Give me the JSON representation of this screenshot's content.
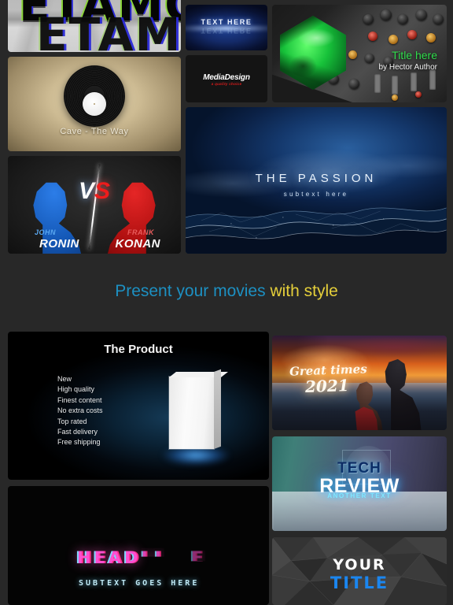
{
  "background_color": "#282828",
  "headline": {
    "part1": "Present your movies",
    "part2": "with style",
    "color1": "#1d90c2",
    "color2": "#e5cf3a"
  },
  "cards": {
    "chrome": {
      "name": "chrome-text-preview",
      "line1": "ETAMO",
      "line2": "ETAMO"
    },
    "text_here": {
      "name": "text-here-preview",
      "title": "TEXT HERE",
      "reflection": "TEXT HERE"
    },
    "media_design": {
      "name": "media-design-preview",
      "title": "MediaDesign",
      "subtitle": "a quality choice",
      "subtitle_color": "#e11b1b"
    },
    "mixer": {
      "name": "audio-mixer-preview",
      "title": "Title here",
      "author": "by Hector Author",
      "title_color": "#2fdc4c"
    },
    "vinyl": {
      "name": "vinyl-record-preview",
      "title": "Cave - The Way"
    },
    "versus": {
      "name": "versus-preview",
      "vs_v": "V",
      "vs_s": "S",
      "left_first": "JOHN",
      "left_last": "RONIN",
      "right_first": "FRANK",
      "right_last": "KONAN",
      "left_color": "#5aa8f0",
      "right_color": "#e85c5c"
    },
    "passion": {
      "name": "the-passion-preview",
      "title": "THE PASSION",
      "subtitle": "subtext here"
    },
    "product": {
      "name": "the-product-preview",
      "title": "The Product",
      "bullets": [
        "New",
        "High quality",
        "Finest content",
        "No extra costs",
        "Top rated",
        "Fast delivery",
        "Free shipping"
      ]
    },
    "sunset": {
      "name": "great-times-preview",
      "line1": "Great times",
      "line2": "2021"
    },
    "tech": {
      "name": "tech-review-preview",
      "line1": "TECH",
      "line2": "REVIEW",
      "line3": "ANOTHER TEXT",
      "line1_color": "#0e2d63",
      "line3_color": "#7fe6ff"
    },
    "glitch": {
      "name": "headline-glitch-preview",
      "title_a": "HEAD",
      "title_b": "LI",
      "title_c": "E",
      "subtitle": "SUBTEXT GOES HERE"
    },
    "your_title": {
      "name": "your-title-preview",
      "line1": "YOUR",
      "line2": "TITLE",
      "line2_color": "#1b86ef"
    }
  }
}
